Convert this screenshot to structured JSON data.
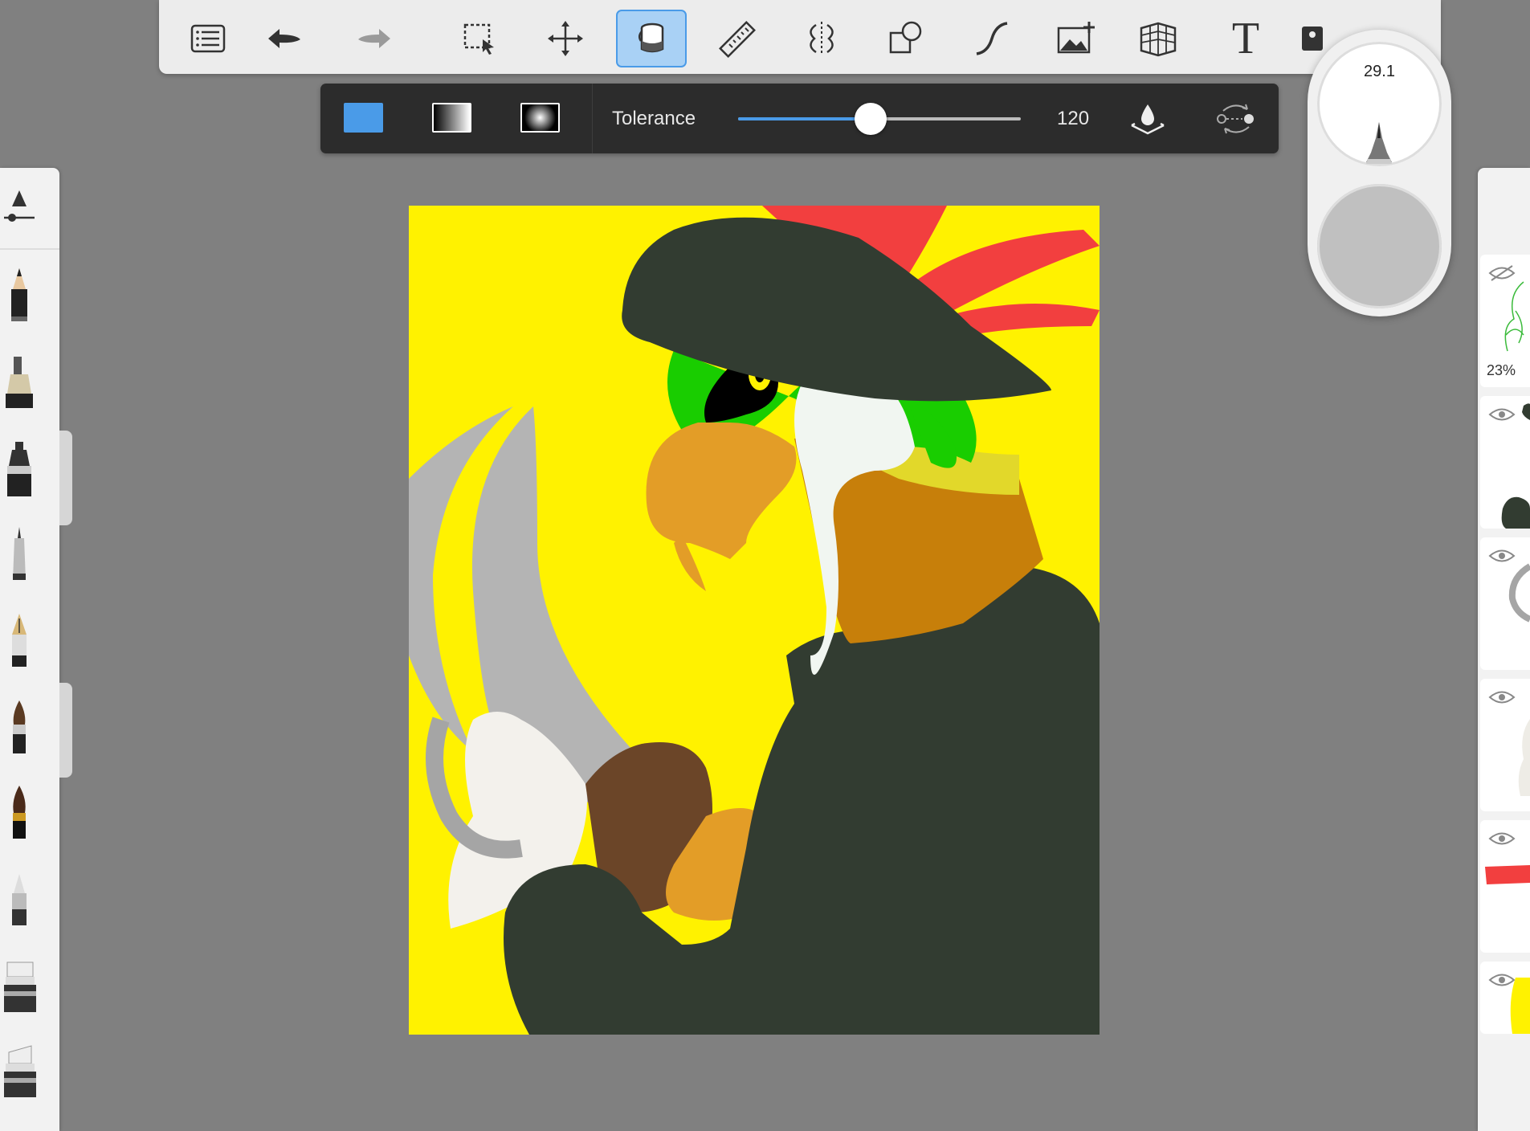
{
  "toolbar": {
    "items": [
      {
        "name": "menu-list",
        "icon": "list-icon"
      },
      {
        "name": "undo",
        "icon": "undo-icon"
      },
      {
        "name": "redo",
        "icon": "redo-icon"
      },
      {
        "name": "selection",
        "icon": "marquee-select-icon"
      },
      {
        "name": "transform",
        "icon": "move-arrows-icon"
      },
      {
        "name": "fill",
        "icon": "paint-bucket-icon",
        "active": true
      },
      {
        "name": "ruler",
        "icon": "ruler-icon"
      },
      {
        "name": "symmetry",
        "icon": "symmetry-icon"
      },
      {
        "name": "shapes",
        "icon": "shapes-icon"
      },
      {
        "name": "curve",
        "icon": "curve-icon"
      },
      {
        "name": "import-image",
        "icon": "image-add-icon"
      },
      {
        "name": "perspective",
        "icon": "perspective-grid-icon"
      },
      {
        "name": "text",
        "icon": "text-icon",
        "glyph": "T"
      },
      {
        "name": "more",
        "icon": "overflow-icon"
      }
    ]
  },
  "fill_options": {
    "tolerance_label": "Tolerance",
    "tolerance_value": "120",
    "tolerance_fraction": 0.47,
    "solid_color": "#4a9be8"
  },
  "puck": {
    "size_value": "29.1",
    "opacity_color": "#c0c0c0"
  },
  "layers": {
    "top_layer_opacity": "23%"
  },
  "colors": {
    "accent": "#4a9be8",
    "canvas_background": "#fff200"
  }
}
